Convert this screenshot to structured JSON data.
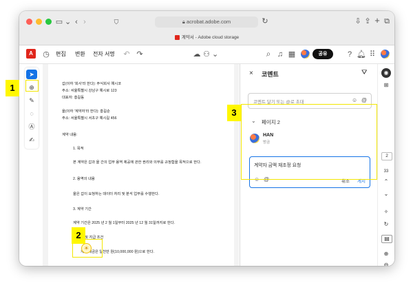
{
  "browser": {
    "url": "acrobat.adobe.com",
    "tab_title": "계약서 - Adobe cloud storage"
  },
  "toolbar": {
    "menu": [
      "편집",
      "변환",
      "전자 서명"
    ],
    "share_label": "공유"
  },
  "document": {
    "lines": [
      "갑(이하 '회사'라 한다): 주식회사 예시코",
      "주소: 서울특별시 강남구 예시로 123",
      "대표자: 홍길동",
      "을(이하 '계약자'라 한다): 홍길순",
      "주소: 서울특별시 서초구 예시길 456",
      "계약 내용:",
      "1.   목적",
      "본 계약은 갑과 을 간의 업무 용역 제공에 관한 권리와 의무를 규정함을 목적으로 한다.",
      "2.   용역의 내용",
      "을은 갑이 요청하는 데이터 처리 및 분석 업무를 수행한다.",
      "3.   계약 기간",
      "계약 기간은 2025 년 2 월 1일부터 2025 년 12 월 31일까지로 한다.",
      "4.   대금 및 지급 조건",
      "계약 대금은 일천만 원(10,000,000 원)으로 한다."
    ]
  },
  "comments": {
    "title": "코멘트",
    "add_placeholder": "코멘트 달기 또는 @로 초대",
    "page_label": "페이지 2",
    "author": "HAN",
    "time": "방금",
    "reply_text": "계약자 금액 재조정 요청",
    "cancel_label": "취소",
    "post_label": "게시"
  },
  "page_nav": {
    "current": "2",
    "total": "33"
  },
  "annotations": {
    "badge1": "1",
    "badge2": "2",
    "badge3": "3"
  },
  "colors": {
    "highlight": "#fff700",
    "accent": "#1473e6",
    "acrobat_red": "#e0261c"
  },
  "icons": [
    "back-icon",
    "forward-icon",
    "sidebar-icon",
    "shield-icon",
    "lock-icon",
    "reload-icon",
    "download-icon",
    "share-icon",
    "plus-icon",
    "tabs-icon",
    "acrobat-logo-icon",
    "history-icon",
    "undo-icon",
    "redo-icon",
    "cloud-icon",
    "collab-icon",
    "search-icon",
    "headphones-icon",
    "help-icon",
    "bell-icon",
    "apps-icon",
    "select-cursor-icon",
    "zoom-comment-icon",
    "pen-icon",
    "lasso-icon",
    "textbox-icon",
    "sign-icon",
    "close-icon",
    "filter-icon",
    "emoji-icon",
    "mention-icon",
    "chevron-down-icon",
    "thumbnails-icon"
  ]
}
